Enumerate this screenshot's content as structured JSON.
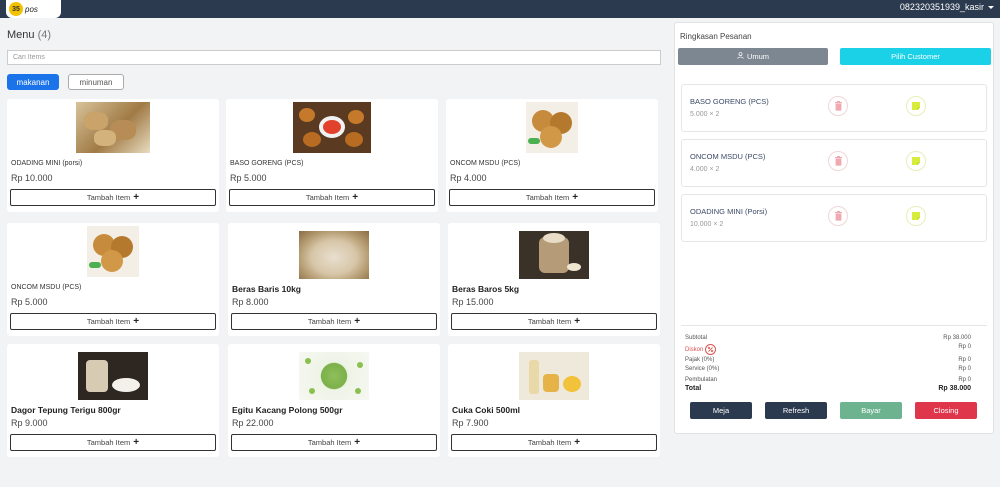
{
  "topbar": {
    "logo_mark": "35",
    "logo_text": "pos",
    "username": "082320351939_kasir"
  },
  "menu": {
    "title": "Menu",
    "count": "(4)",
    "search_placeholder": "Cari Items",
    "categories": [
      {
        "label": "makanan",
        "active": true
      },
      {
        "label": "minuman",
        "active": false
      }
    ]
  },
  "products": [
    {
      "name": "ODADING MINI (porsi)",
      "price": "Rp 10.000",
      "button": "Tambah Item",
      "image": "fried-dough-image"
    },
    {
      "name": "BASO GORENG (PCS)",
      "price": "Rp 5.000",
      "button": "Tambah Item",
      "image": "fried-meatball-image"
    },
    {
      "name": "ONCOM MSDU (PCS)",
      "price": "Rp 4.000",
      "button": "Tambah Item",
      "image": "oncom-image"
    },
    {
      "name": "ONCOM MSDU (PCS)",
      "price": "Rp 5.000",
      "button": "Tambah Item",
      "image": "oncom-image"
    },
    {
      "name": "Beras Baris 10kg",
      "price": "Rp 8.000",
      "button": "Tambah Item",
      "image": "rice-image"
    },
    {
      "name": "Beras Baros 5kg",
      "price": "Rp 15.000",
      "button": "Tambah Item",
      "image": "rice-sack-image"
    },
    {
      "name": "Dagor Tepung Terigu 800gr",
      "price": "Rp 9.000",
      "button": "Tambah Item",
      "image": "flour-image"
    },
    {
      "name": "Egitu Kacang Polong 500gr",
      "price": "Rp 22.000",
      "button": "Tambah Item",
      "image": "green-peas-image"
    },
    {
      "name": "Cuka Coki 500ml",
      "price": "Rp 7.900",
      "button": "Tambah Item",
      "image": "vinegar-image"
    }
  ],
  "order_panel": {
    "title": "Ringkasan Pesanan",
    "umum_label": "Umum",
    "customer_label": "Pilih Customer",
    "items": [
      {
        "name": "BASO GORENG (PCS)",
        "qty": "5.000 × 2"
      },
      {
        "name": "ONCOM MSDU (PCS)",
        "qty": "4.000 × 2"
      },
      {
        "name": "ODADING MINI (Porsi)",
        "qty": "10.000 × 2"
      }
    ],
    "summary": {
      "subtotal_label": "Subtotal",
      "subtotal": "Rp 38.000",
      "diskon_label": "Diskon",
      "diskon": "Rp 0",
      "pajak_label": "Pajak (0%)",
      "pajak": "Rp 0",
      "service_label": "Service (0%)",
      "service": "Rp 0",
      "pembulatan_label": "Pembulatan",
      "pembulatan": "Rp 0",
      "total_label": "Total",
      "total": "Rp 38.000"
    },
    "actions": [
      {
        "label": "Meja",
        "color": "#2b3a4f"
      },
      {
        "label": "Refresh",
        "color": "#2b3a4f"
      },
      {
        "label": "Bayar",
        "color": "#6db38f"
      },
      {
        "label": "Closing",
        "color": "#e0364b"
      }
    ]
  }
}
